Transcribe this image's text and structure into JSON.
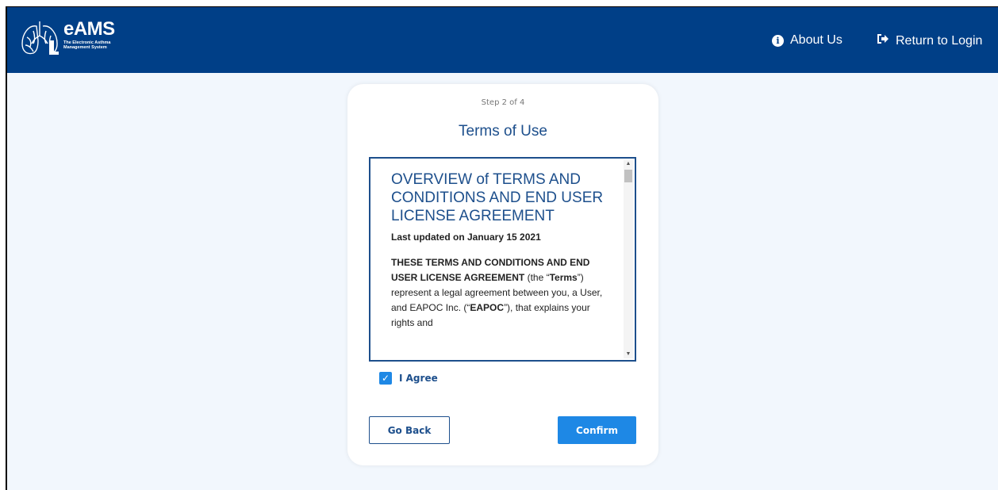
{
  "header": {
    "logo": {
      "title": "eAMS",
      "subtitle": "The Electronic Asthma Management System",
      "icon": "lungs-icon"
    },
    "nav": [
      {
        "label": "About Us",
        "icon": "info-circle-icon"
      },
      {
        "label": "Return to Login",
        "icon": "sign-out-icon"
      }
    ]
  },
  "card": {
    "step": "Step 2 of 4",
    "title": "Terms of Use",
    "terms": {
      "heading": "OVERVIEW of TERMS AND CONDITIONS AND END USER LICENSE AGREEMENT",
      "updated": "Last updated on January 15 2021",
      "body_bold_1": "THESE TERMS AND CONDITIONS AND END USER LICENSE AGREEMENT",
      "body_1": " (the “",
      "body_bold_2": "Terms",
      "body_2": "”) represent a legal agreement between you, a User, and EAPOC Inc. (“",
      "body_bold_3": "EAPOC",
      "body_3": "”), that explains your rights and"
    },
    "agree_label": "I Agree",
    "agree_checked": true,
    "back_label": "Go Back",
    "confirm_label": "Confirm"
  },
  "colors": {
    "header_bg": "#003f87",
    "accent": "#1e88e5",
    "title": "#1d4f8c",
    "page_bg": "#f2f7fd"
  }
}
